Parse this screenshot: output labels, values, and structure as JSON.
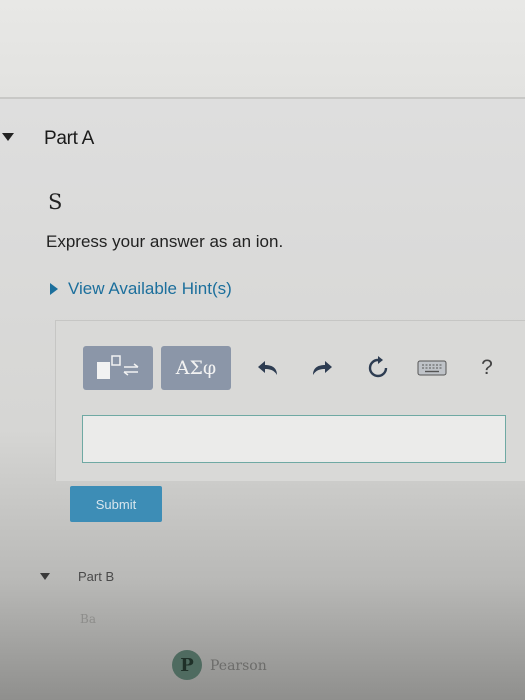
{
  "part_a": {
    "title": "Part A"
  },
  "question": {
    "symbol": "S",
    "instructions": "Express your answer as an ion.",
    "hints_label": "View Available Hint(s)"
  },
  "toolbar": {
    "greek_label": "ΑΣφ",
    "help_label": "?"
  },
  "answer": {
    "value": ""
  },
  "submit_label": "Submit",
  "part_b": {
    "title": "Part B",
    "faded_text": "Ba"
  },
  "footer": {
    "logo_letter": "P",
    "logo_text": "Pearson"
  },
  "colors": {
    "link": "#1c6f9c",
    "toolbar_button": "#8b96a8",
    "submit": "#3d8db6",
    "input_border": "#6fa9a3"
  }
}
